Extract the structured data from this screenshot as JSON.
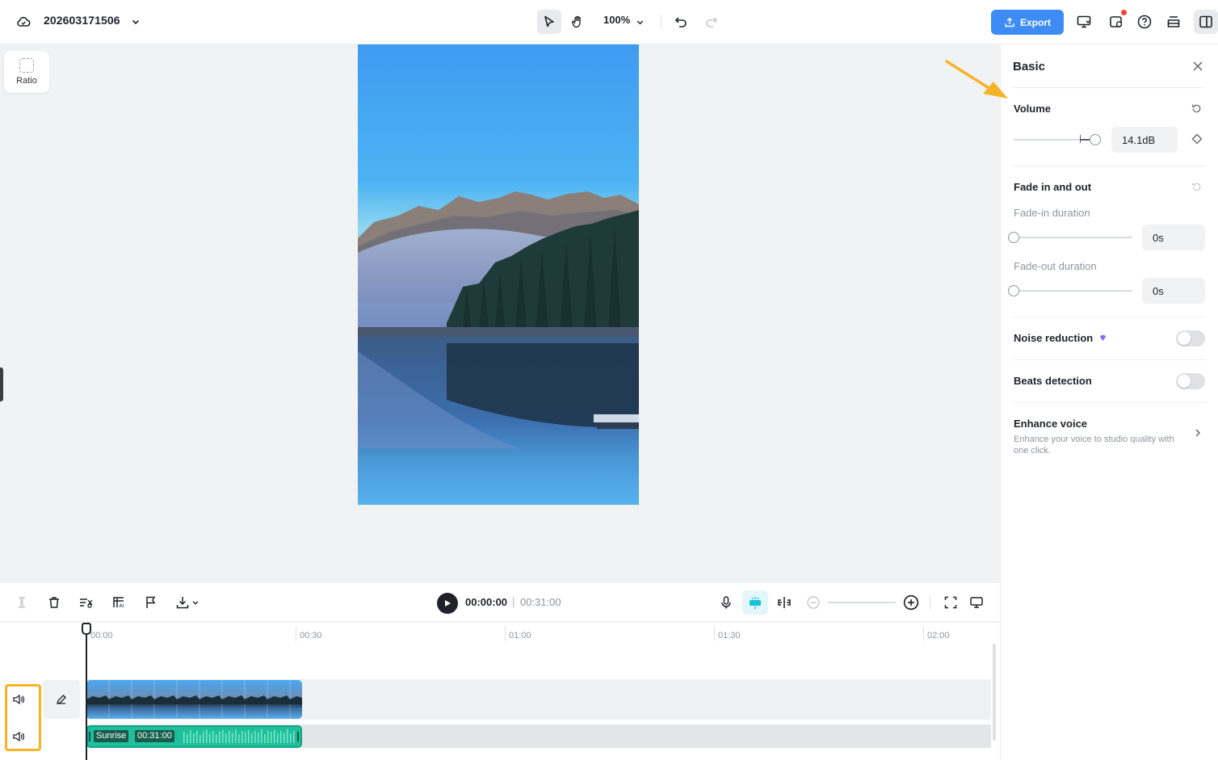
{
  "topbar": {
    "project_title": "202603171506",
    "zoom": "100%",
    "export_label": "Export"
  },
  "canvas": {
    "ratio_label": "Ratio"
  },
  "panel": {
    "title": "Basic",
    "volume": {
      "title": "Volume",
      "value": "14.1dB",
      "level": 0.78
    },
    "fade": {
      "title": "Fade in and out",
      "fade_in_label": "Fade-in duration",
      "fade_in_value": "0s",
      "fade_out_label": "Fade-out duration",
      "fade_out_value": "0s"
    },
    "noise_reduction": {
      "title": "Noise reduction",
      "enabled": false
    },
    "beats_detection": {
      "title": "Beats detection",
      "enabled": false
    },
    "enhance_voice": {
      "title": "Enhance voice",
      "description": "Enhance your voice to studio quality with one click."
    }
  },
  "timeline": {
    "current_time": "00:00:00",
    "separator": "|",
    "total_time": "00:31:00",
    "ruler": [
      "00:00",
      "00:30",
      "01:00",
      "01:30",
      "02:00"
    ],
    "audio_clip": {
      "name": "Sunrise",
      "duration": "00:31:00"
    }
  },
  "colors": {
    "accent": "#3d8cf5",
    "highlight": "#f5b427",
    "audio_clip": "#1fbf9b"
  }
}
